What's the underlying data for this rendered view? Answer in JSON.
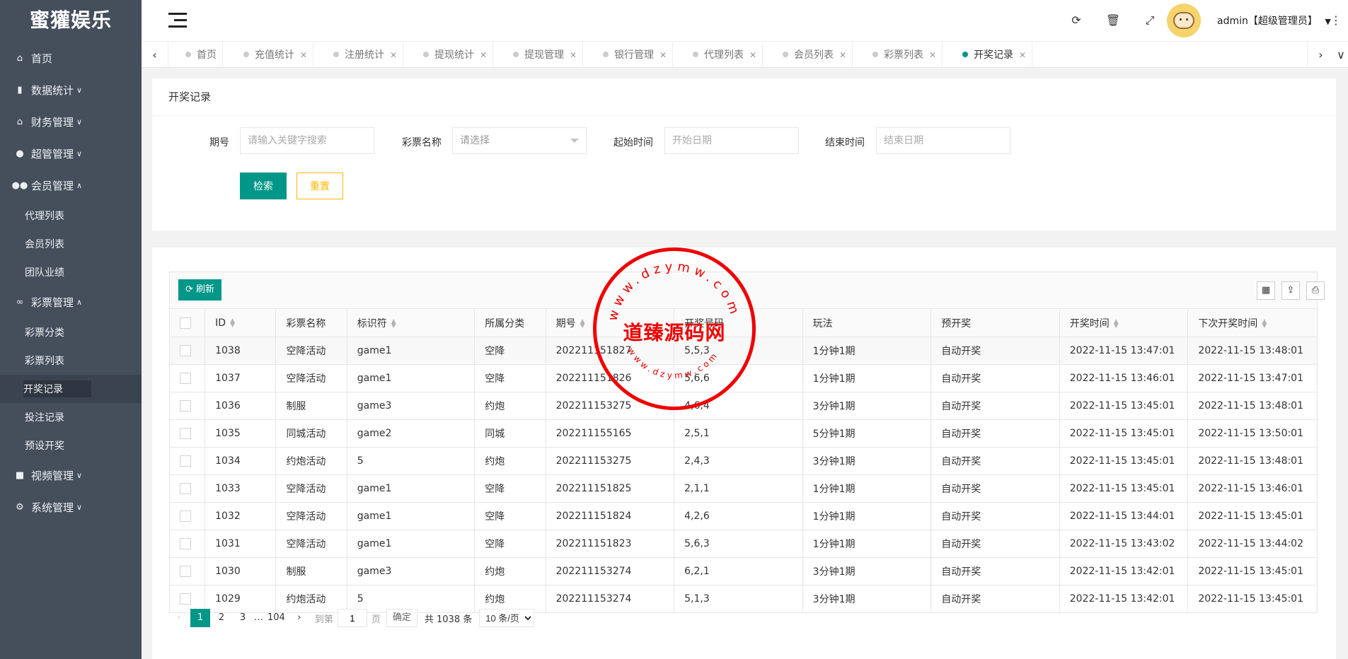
{
  "app": {
    "logo": "蜜獾娱乐"
  },
  "sidebar": {
    "items": [
      {
        "label": "首页",
        "icon": "home-icon"
      },
      {
        "label": "数据统计",
        "icon": "bar-chart-icon"
      },
      {
        "label": "财务管理",
        "icon": "bank-icon"
      },
      {
        "label": "超管管理",
        "icon": "user-icon"
      },
      {
        "label": "会员管理",
        "icon": "users-icon"
      }
    ],
    "member_sub": [
      "代理列表",
      "会员列表",
      "团队业绩"
    ],
    "lottery": {
      "label": "彩票管理",
      "icon": "link-icon"
    },
    "lottery_sub": [
      "彩票分类",
      "彩票列表",
      "开奖记录",
      "投注记录",
      "预设开奖"
    ],
    "video": {
      "label": "视频管理",
      "icon": "video-icon"
    },
    "system": {
      "label": "系统管理",
      "icon": "gear-icon"
    }
  },
  "header": {
    "user": "admin【超级管理员】"
  },
  "tabs": [
    "首页",
    "充值统计",
    "注册统计",
    "提现统计",
    "提现管理",
    "银行管理",
    "代理列表",
    "会员列表",
    "彩票列表",
    "开奖记录"
  ],
  "search": {
    "title": "开奖记录",
    "issue_label": "期号",
    "issue_placeholder": "请输入关键字搜索",
    "lottery_label": "彩票名称",
    "lottery_placeholder": "请选择",
    "start_label": "起始时间",
    "start_placeholder": "开始日期",
    "end_label": "结束时间",
    "end_placeholder": "结束日期",
    "search_btn": "检索",
    "reset_btn": "重置"
  },
  "table": {
    "refresh": "刷新",
    "columns": [
      "ID",
      "彩票名称",
      "标识符",
      "所属分类",
      "期号",
      "开奖号码",
      "玩法",
      "预开奖",
      "开奖时间",
      "下次开奖时间"
    ],
    "rows": [
      [
        "1038",
        "空降活动",
        "game1",
        "空降",
        "202211151827",
        "5,5,3",
        "1分钟1期",
        "自动开奖",
        "2022-11-15 13:47:01",
        "2022-11-15 13:48:01"
      ],
      [
        "1037",
        "空降活动",
        "game1",
        "空降",
        "202211151826",
        "5,6,6",
        "1分钟1期",
        "自动开奖",
        "2022-11-15 13:46:01",
        "2022-11-15 13:47:01"
      ],
      [
        "1036",
        "制服",
        "game3",
        "约炮",
        "202211153275",
        "4,6,4",
        "3分钟1期",
        "自动开奖",
        "2022-11-15 13:45:01",
        "2022-11-15 13:48:01"
      ],
      [
        "1035",
        "同城活动",
        "game2",
        "同城",
        "202211155165",
        "2,5,1",
        "5分钟1期",
        "自动开奖",
        "2022-11-15 13:45:01",
        "2022-11-15 13:50:01"
      ],
      [
        "1034",
        "约炮活动",
        "5",
        "约炮",
        "202211153275",
        "2,4,3",
        "3分钟1期",
        "自动开奖",
        "2022-11-15 13:45:01",
        "2022-11-15 13:48:01"
      ],
      [
        "1033",
        "空降活动",
        "game1",
        "空降",
        "202211151825",
        "2,1,1",
        "1分钟1期",
        "自动开奖",
        "2022-11-15 13:45:01",
        "2022-11-15 13:46:01"
      ],
      [
        "1032",
        "空降活动",
        "game1",
        "空降",
        "202211151824",
        "4,2,6",
        "1分钟1期",
        "自动开奖",
        "2022-11-15 13:44:01",
        "2022-11-15 13:45:01"
      ],
      [
        "1031",
        "空降活动",
        "game1",
        "空降",
        "202211151823",
        "5,6,3",
        "1分钟1期",
        "自动开奖",
        "2022-11-15 13:43:02",
        "2022-11-15 13:44:02"
      ],
      [
        "1030",
        "制服",
        "game3",
        "约炮",
        "202211153274",
        "6,2,1",
        "3分钟1期",
        "自动开奖",
        "2022-11-15 13:42:01",
        "2022-11-15 13:45:01"
      ],
      [
        "1029",
        "约炮活动",
        "5",
        "约炮",
        "202211153274",
        "5,1,3",
        "3分钟1期",
        "自动开奖",
        "2022-11-15 13:42:01",
        "2022-11-15 13:45:01"
      ]
    ]
  },
  "pager": {
    "pages": [
      "1",
      "2",
      "3",
      "…",
      "104"
    ],
    "goto": "到第",
    "page_value": "1",
    "page_unit": "页",
    "ok": "确定",
    "total": "共 1038 条",
    "size": "10 条/页"
  },
  "watermark": {
    "text": "道臻源码网",
    "ring": "www.dzymw.com"
  },
  "colors": {
    "primary": "#009688",
    "warn": "#ffb800",
    "sidebar": "#454f5c"
  }
}
